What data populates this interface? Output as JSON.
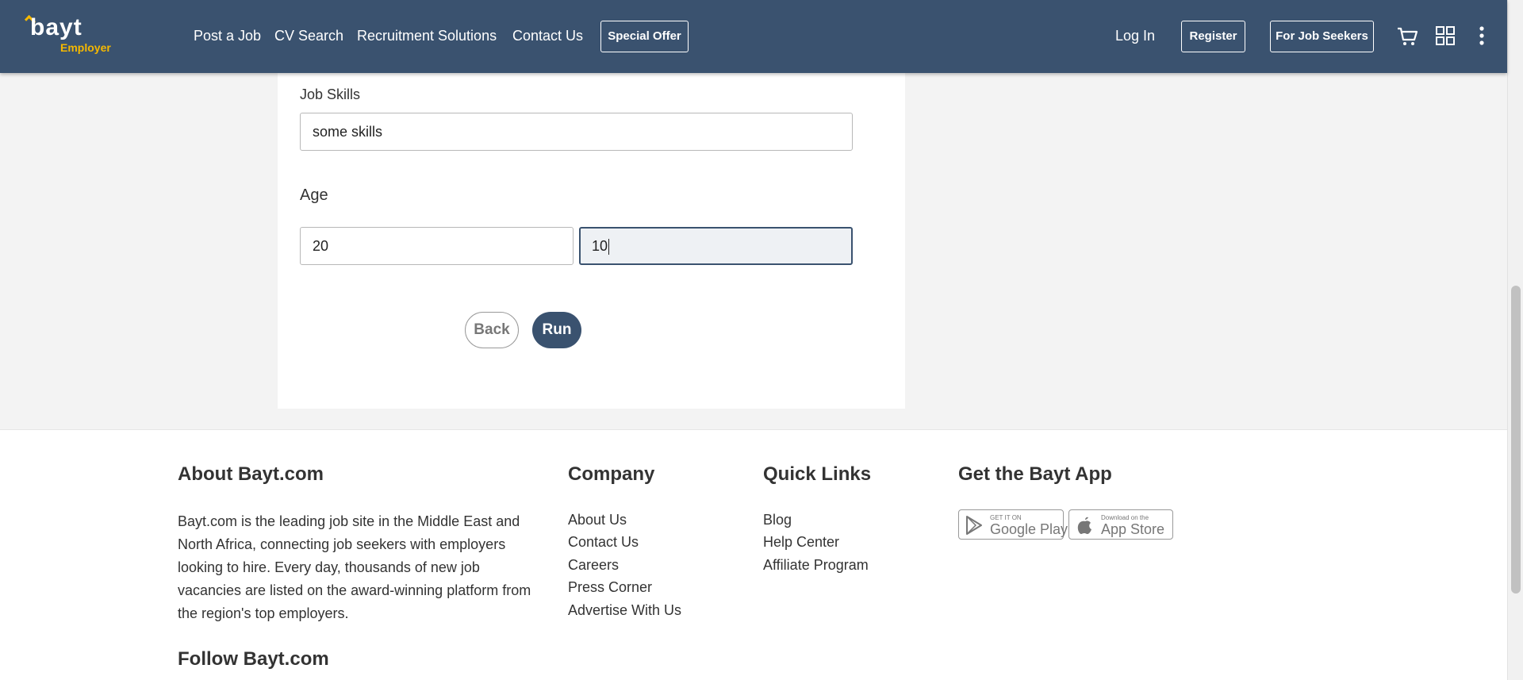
{
  "header": {
    "logo_text": "bayt",
    "logo_sub": "Employer",
    "nav": [
      "Post a Job",
      "CV Search",
      "Recruitment Solutions",
      "Contact Us"
    ],
    "special_offer": "Special Offer",
    "login": "Log In",
    "register": "Register",
    "job_seekers": "For Job Seekers",
    "icons": [
      "cart-icon",
      "grid-icon",
      "more-vertical-icon"
    ]
  },
  "form": {
    "job_skills_label": "Job Skills",
    "job_skills_value": "some skills",
    "age_label": "Age",
    "age_from_value": "20",
    "age_to_value": "10",
    "back_label": "Back",
    "run_label": "Run"
  },
  "footer": {
    "about": {
      "title": "About Bayt.com",
      "text": "Bayt.com is the leading job site in the Middle East and North Africa, connecting job seekers with employers looking to hire. Every day, thousands of new job vacancies are listed on the award-winning platform from the region's top employers."
    },
    "follow_title": "Follow Bayt.com",
    "company": {
      "title": "Company",
      "links": [
        "About Us",
        "Contact Us",
        "Careers",
        "Press Corner",
        "Advertise With Us"
      ]
    },
    "quick_links": {
      "title": "Quick Links",
      "links": [
        "Blog",
        "Help Center",
        "Affiliate Program"
      ]
    },
    "app": {
      "title": "Get the Bayt App",
      "google_small": "GET IT ON",
      "google_big": "Google Play",
      "apple_small": "Download on the",
      "apple_big": "App Store"
    }
  },
  "colors": {
    "header_bg": "#3a526f",
    "logo_accent": "#f5b800",
    "run_button": "#3a526f"
  }
}
